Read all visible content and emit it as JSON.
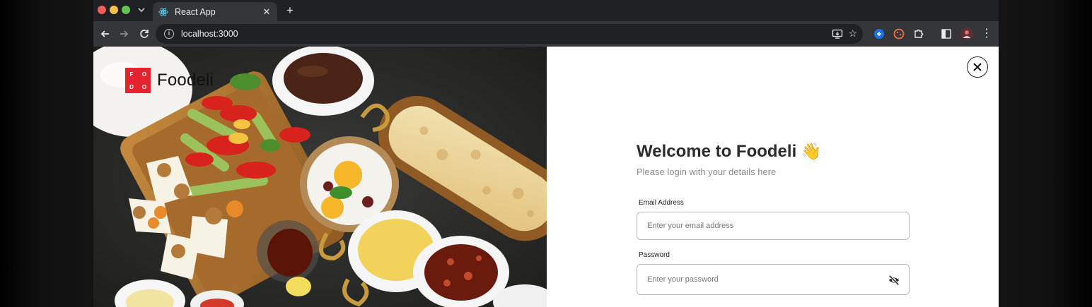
{
  "browser": {
    "tab": {
      "title": "React App",
      "favicon": "react-icon",
      "close_glyph": "✕"
    },
    "new_tab_glyph": "+",
    "address": {
      "url": "localhost:3000"
    },
    "colors": {
      "frame": "#202124",
      "toolbar": "#35363a"
    }
  },
  "brand": {
    "logo_letters": [
      "F",
      "O",
      "D",
      "O"
    ],
    "name": "Foodeli",
    "color": "#e5232e"
  },
  "login": {
    "title": "Welcome to Foodeli",
    "emoji": "👋",
    "subtitle": "Please login with your details here",
    "email": {
      "label": "Email Address",
      "placeholder": "Enter your email address"
    },
    "password": {
      "label": "Password",
      "placeholder": "Enter your password",
      "toggle_icon": "eye-off-icon"
    }
  }
}
